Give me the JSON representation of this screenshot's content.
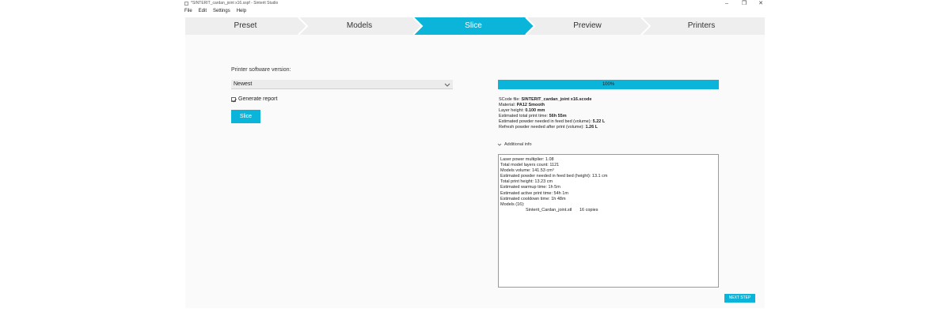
{
  "window": {
    "title": "*SINTERIT_cardan_joint x16.sspf - Sinterit Studio",
    "minimize": "–",
    "restore": "❐",
    "close": "✕"
  },
  "menu": [
    "File",
    "Edit",
    "Settings",
    "Help"
  ],
  "steps": [
    {
      "label": "Preset",
      "active": false
    },
    {
      "label": "Models",
      "active": false
    },
    {
      "label": "Slice",
      "active": true
    },
    {
      "label": "Preview",
      "active": false
    },
    {
      "label": "Printers",
      "active": false
    }
  ],
  "colors": {
    "accent": "#0bb4d9",
    "step_bg": "#eeeeee"
  },
  "slice_panel": {
    "version_label": "Printer software version:",
    "version_value": "Newest",
    "generate_report_label": "Generate report",
    "generate_report_checked": true,
    "slice_button": "Slice"
  },
  "progress": {
    "text": "100%",
    "value": 1.0
  },
  "summary": [
    {
      "label": "SCode file: ",
      "value": "SINTERIT_cardan_joint x16.scode"
    },
    {
      "label": "Material: ",
      "value": "PA12 Smooth"
    },
    {
      "label": "Layer height: ",
      "value": "0.100 mm"
    },
    {
      "label": "Estimated total print time: ",
      "value": "56h 55m"
    },
    {
      "label": "Estimated powder needed in feed bed (volume): ",
      "value": "5.22 L"
    },
    {
      "label": "Refresh powder needed after print (volume): ",
      "value": "1.26 L"
    }
  ],
  "additional_info": {
    "toggle_label": "Additional info",
    "lines": [
      "Laser power multiplier: 1.08",
      "Total model layers count: 1121",
      "Models volume: 141.53 cm³",
      "Estimated powder needed in feed bed (height): 13.1 cm",
      "Total print height: 13.23 cm",
      "Estimated warmup time: 1h 5m",
      "Estimated active print time: 54h 1m",
      "Estimated cooldown time: 1h 48m",
      "Models (16):"
    ],
    "model_file": "Sinterit_Cardan_joint.stl",
    "model_copies": "16 copies"
  },
  "next_button": "NEXT STEP"
}
